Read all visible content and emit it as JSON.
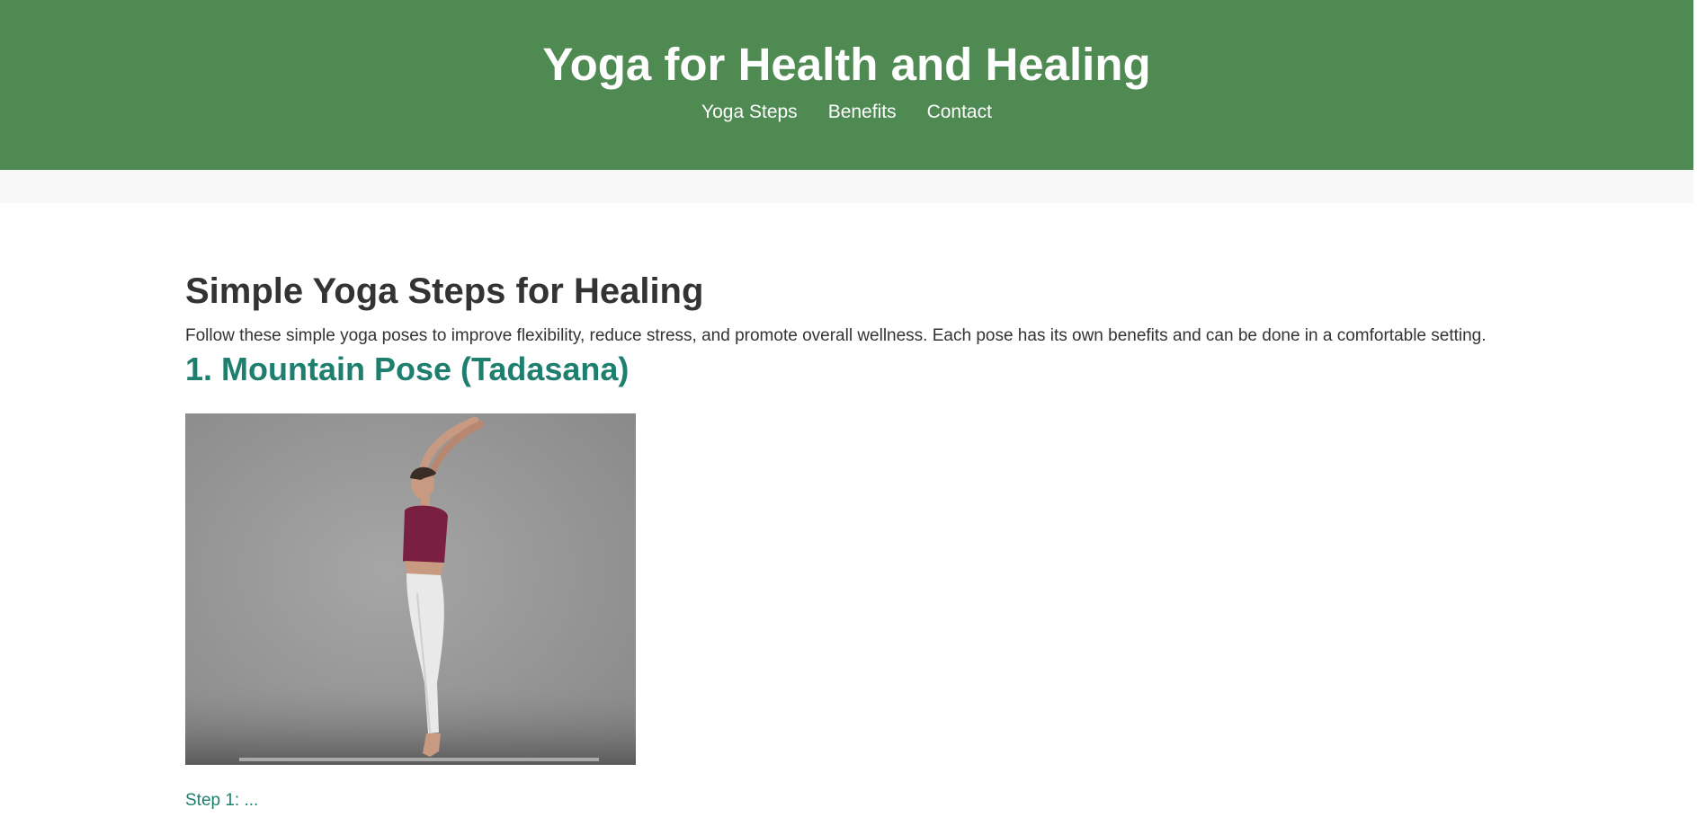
{
  "header": {
    "title": "Yoga for Health and Healing",
    "nav": [
      {
        "label": "Yoga Steps"
      },
      {
        "label": "Benefits"
      },
      {
        "label": "Contact"
      }
    ]
  },
  "main": {
    "heading": "Simple Yoga Steps for Healing",
    "intro": "Follow these simple yoga poses to improve flexibility, reduce stress, and promote overall wellness. Each pose has its own benefits and can be done in a comfortable setting.",
    "poses": [
      {
        "title": "1. Mountain Pose (Tadasana)",
        "image_icon": "yoga-mountain-pose-photo"
      }
    ],
    "partial_link": "Step 1: ..."
  },
  "colors": {
    "header_bg": "#4f8a53",
    "accent": "#1e7f6f",
    "text": "#333333"
  }
}
